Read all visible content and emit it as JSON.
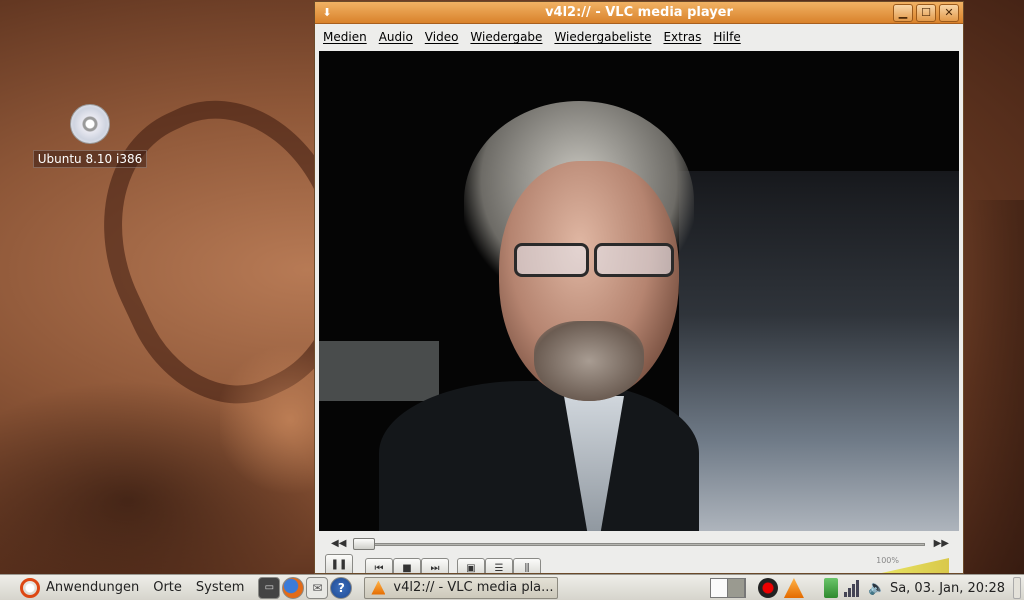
{
  "desktop": {
    "icon_label": "Ubuntu 8.10 i386"
  },
  "window": {
    "title": "v4l2:// - VLC media player",
    "controls": {
      "minimize": "▁",
      "maximize": "☐",
      "close": "✕"
    },
    "menu": [
      "Medien",
      "Audio",
      "Video",
      "Wiedergabe",
      "Wiedergabeliste",
      "Extras",
      "Hilfe"
    ],
    "volume_label": "100%"
  },
  "panel": {
    "menus": [
      "Anwendungen",
      "Orte",
      "System"
    ],
    "task_title": "v4l2:// - VLC media pla...",
    "clock": "Sa, 03. Jan, 20:28"
  },
  "colors": {
    "titlebar": "#d9822b",
    "ubuntu_orange": "#dd4814"
  }
}
